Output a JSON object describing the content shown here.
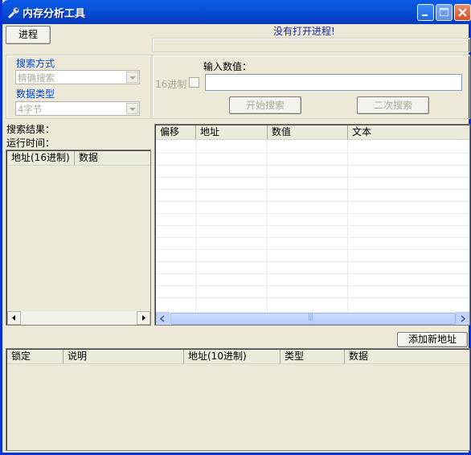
{
  "window": {
    "title": "内存分析工具"
  },
  "toolbar": {
    "process_button": "进程",
    "status": "没有打开进程!"
  },
  "search_panel": {
    "mode_label": "搜索方式",
    "mode_value": "精确搜索",
    "type_label": "数据类型",
    "type_value": "4字节",
    "input_label": "输入数值：",
    "hex_label": "16进制",
    "start_button": "开始搜索",
    "second_button": "二次搜索"
  },
  "results": {
    "result_label": "搜索结果：",
    "runtime_label": "运行时间：",
    "columns": [
      "地址(16进制)",
      "数据"
    ]
  },
  "memory_view": {
    "columns": [
      "偏移",
      "地址",
      "数值",
      "文本"
    ],
    "scroll_grip": "|||"
  },
  "saved": {
    "add_button": "添加新地址",
    "columns": [
      "锁定",
      "说明",
      "地址(10进制)",
      "类型",
      "数据"
    ]
  }
}
